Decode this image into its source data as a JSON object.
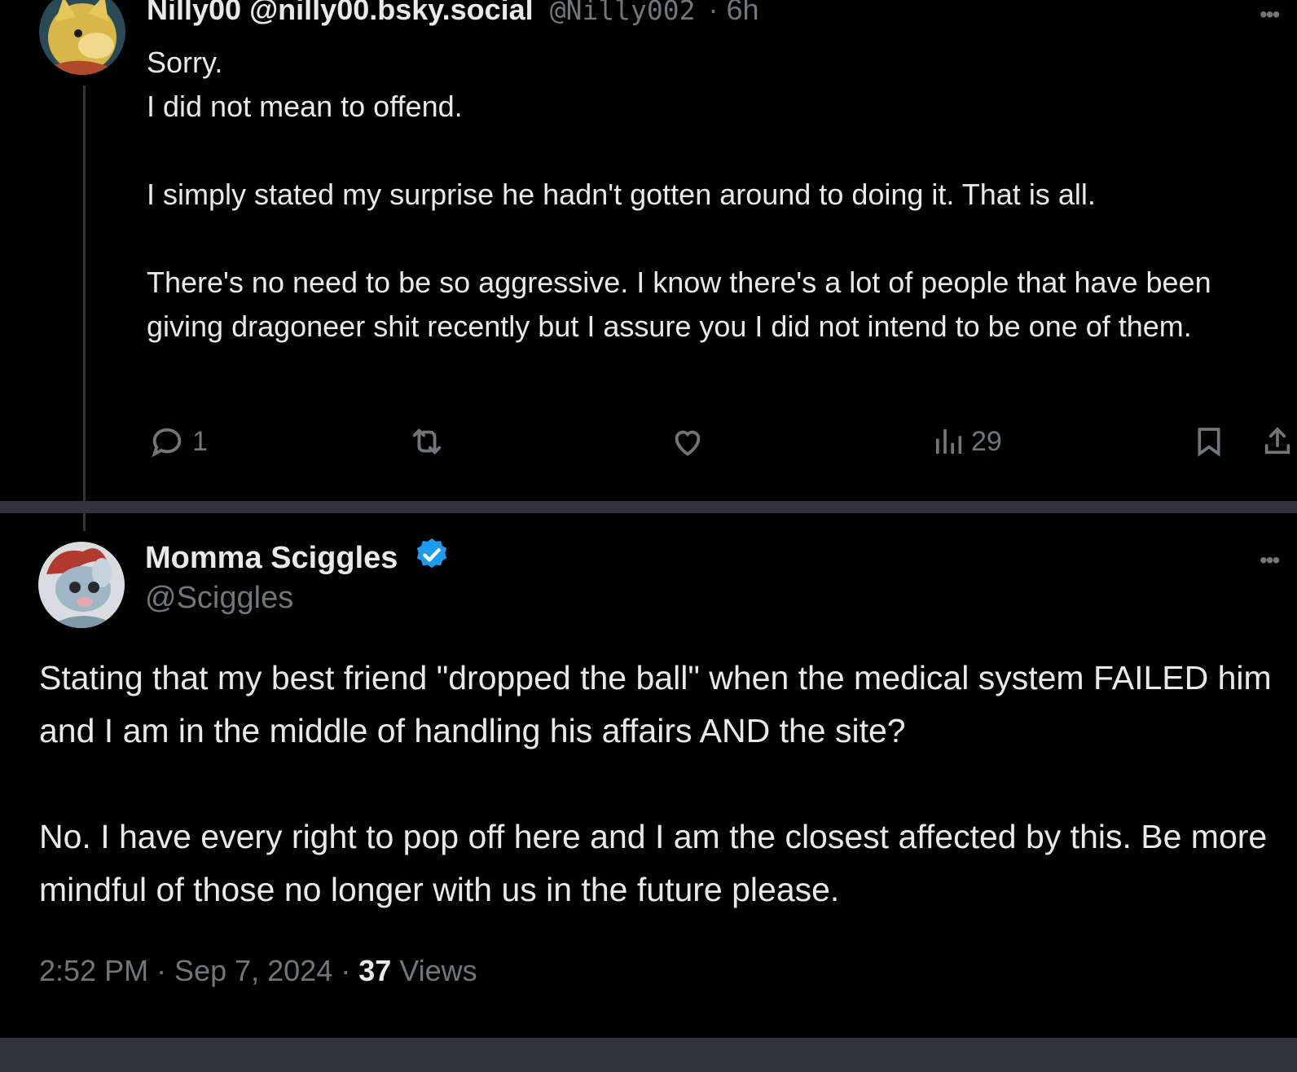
{
  "reply_post": {
    "display_name": "Nilly00 @nilly00.bsky.social",
    "handle": "@Nilly002",
    "time_ago": "· 6h",
    "body": "Sorry.\nI did not mean to offend.\n\nI simply stated my surprise he hadn't gotten around to doing it. That is all.\n\nThere's no need to be so aggressive. I know there's a lot of people that have been giving dragoneer shit recently but I assure you I did not intend to be one of them.",
    "actions": {
      "reply_count": "1",
      "repost_count": "",
      "like_count": "",
      "views_count": "29"
    },
    "icons": [
      "reply-icon",
      "repost-icon",
      "like-icon",
      "views-icon",
      "bookmark-icon",
      "share-icon",
      "more-icon"
    ]
  },
  "main_post": {
    "display_name": "Momma Sciggles",
    "verified": true,
    "handle": "@Sciggles",
    "body": "Stating that my best friend \"dropped the ball\" when the medical system FAILED him and I am in the middle of handling his affairs AND the site?\n\nNo. I have every right to pop off here and I am the closest affected by this. Be more mindful of those no longer with us in the future please.",
    "timestamp": "2:52 PM · Sep 7, 2024 · ",
    "views_count": "37",
    "views_label": " Views"
  },
  "colors": {
    "background": "#000000",
    "separator": "#30333b",
    "text_primary": "#e7e9ea",
    "text_secondary": "#71767b",
    "verified_badge": "#1d9bf0"
  }
}
